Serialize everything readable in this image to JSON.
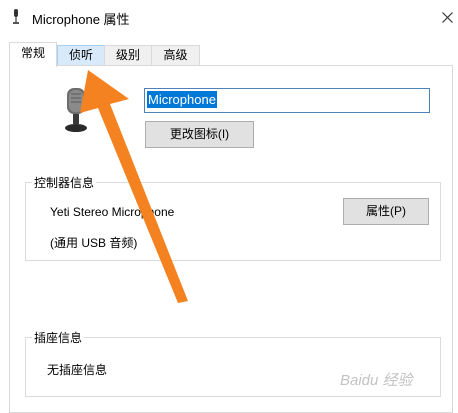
{
  "window": {
    "title": "Microphone 属性",
    "close_icon": "close-icon"
  },
  "tabs": [
    {
      "label": "常规",
      "active": true
    },
    {
      "label": "侦听",
      "active": false
    },
    {
      "label": "级别",
      "active": false
    },
    {
      "label": "高级",
      "active": false
    }
  ],
  "general": {
    "device_name_value": "Microphone",
    "change_icon_label": "更改图标(I)",
    "controller": {
      "heading": "控制器信息",
      "device": "Yeti Stereo Microphone",
      "subtitle": "(通用 USB 音频)",
      "properties_label": "属性(P)"
    },
    "jack": {
      "heading": "插座信息",
      "info": "无插座信息"
    }
  },
  "overlay": {
    "arrow_color": "#f58220",
    "watermark": "Baidu 经验"
  }
}
